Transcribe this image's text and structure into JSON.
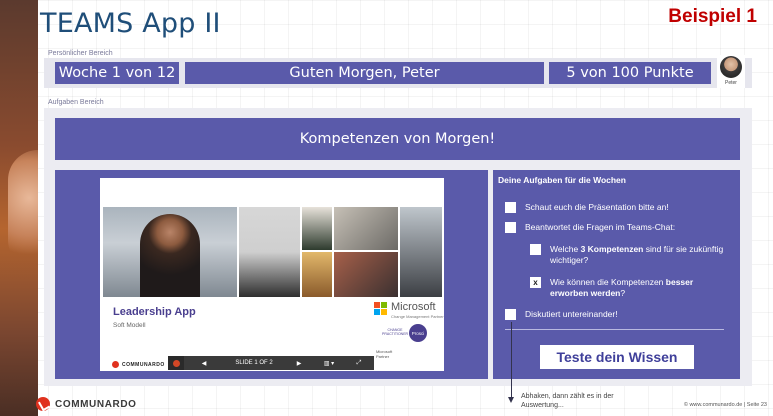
{
  "header": {
    "title": "TEAMS App II",
    "example_label": "Beispiel 1"
  },
  "personal": {
    "section_label": "Persönlicher Bereich",
    "week": "Woche 1 von 12",
    "greeting": "Guten Morgen, Peter",
    "points": "5 von 100 Punkte",
    "user_name": "Peter"
  },
  "tasks_area": {
    "section_label": "Aufgaben Bereich",
    "banner": "Kompetenzen von Morgen!"
  },
  "slide": {
    "title": "Leadership App",
    "subtitle": "Soft Modell",
    "microsoft": "Microsoft",
    "microsoft_sub": "Change Management Partner",
    "badge_round": "Prosci",
    "badge_small": "CHANGE PRACTITIONER",
    "partner_line1": "Microsoft",
    "partner_line2": "Partner",
    "logo_text": "COMMUNARDO",
    "controls": {
      "prev_icon": "◀",
      "slide_counter": "SLIDE 1 OF 2",
      "next_icon": "▶",
      "grid_icon": "▥ ▾",
      "fullscreen_icon": "⤢"
    }
  },
  "tasks": {
    "heading": "Deine Aufgaben für die Wochen",
    "items": [
      {
        "text": "Schaut euch die Präsentation bitte an!",
        "checked": ""
      },
      {
        "text": "Beantwortet die Fragen im Teams-Chat:",
        "checked": ""
      },
      {
        "text_pre": "Welche ",
        "text_bold": "3 Kompetenzen",
        "text_post": " sind für sie zukünftig wichtiger?",
        "checked": ""
      },
      {
        "text_pre": "Wie können die Kompetenzen ",
        "text_bold": "besser erworben werden",
        "text_post": "?",
        "checked": "x"
      },
      {
        "text": "Diskutiert untereinander!",
        "checked": ""
      }
    ],
    "cta": "Teste dein Wissen"
  },
  "annotation": {
    "note": "Abhaken, dann zählt es in der Auswertung..."
  },
  "footer": {
    "logo": "COMMUNARDO",
    "copyright": "© www.communardo.de | Seite 23"
  },
  "colors": {
    "accent": "#5a5aaa",
    "title": "#1f4e79",
    "example": "#c00000",
    "brand_red": "#e0321f"
  }
}
